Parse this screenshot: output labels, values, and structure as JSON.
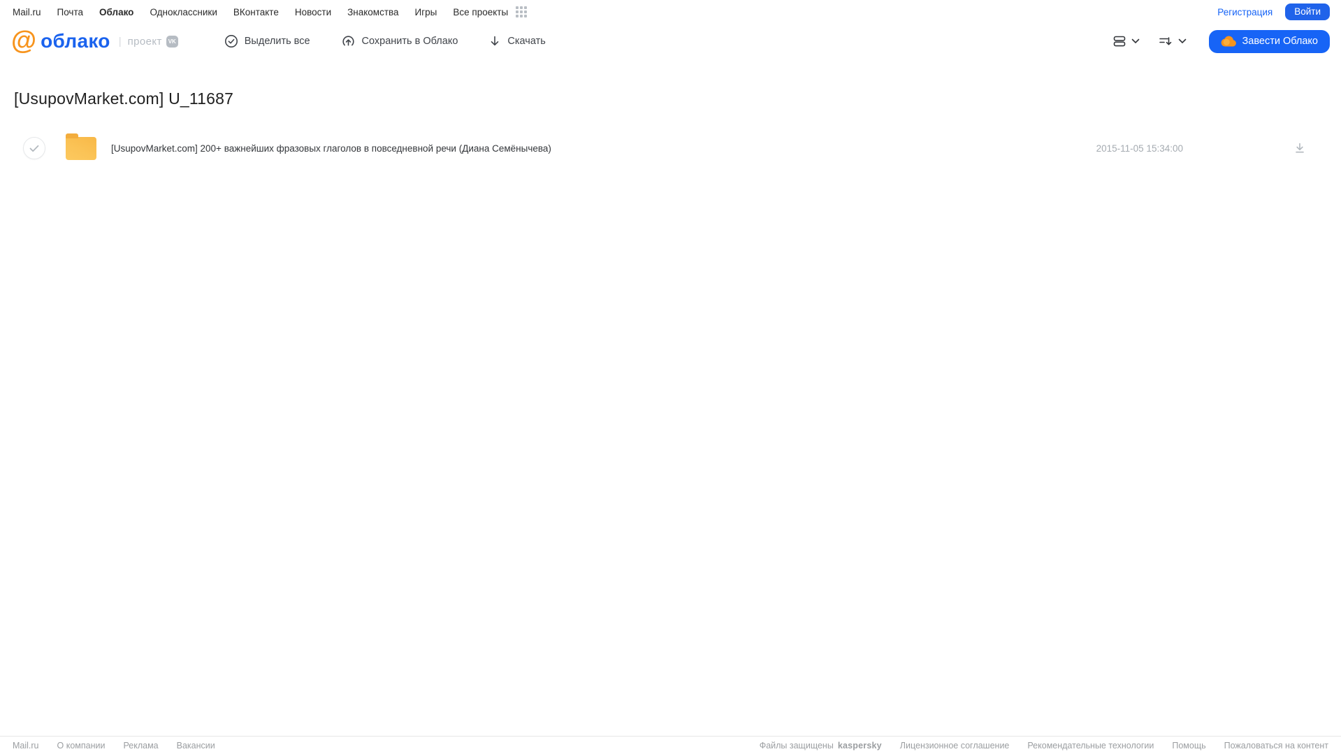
{
  "topnav": {
    "items": [
      {
        "label": "Mail.ru",
        "active": false
      },
      {
        "label": "Почта",
        "active": false
      },
      {
        "label": "Облако",
        "active": true
      },
      {
        "label": "Одноклассники",
        "active": false
      },
      {
        "label": "ВКонтакте",
        "active": false
      },
      {
        "label": "Новости",
        "active": false
      },
      {
        "label": "Знакомства",
        "active": false
      },
      {
        "label": "Игры",
        "active": false
      },
      {
        "label": "Все проекты",
        "active": false
      }
    ],
    "registration_label": "Регистрация",
    "login_label": "Войти"
  },
  "header": {
    "logo_at": "@",
    "logo_word": "облако",
    "logo_divider": "|",
    "logo_project": "проект",
    "vk_badge": "VK",
    "toolbar": {
      "select_all": "Выделить все",
      "save_to_cloud": "Сохранить в Облако",
      "download": "Скачать"
    },
    "get_cloud_label": "Завести Облако"
  },
  "page": {
    "title": "[UsupovMarket.com] U_11687"
  },
  "files": [
    {
      "type": "folder",
      "name": "[UsupovMarket.com] 200+ важнейших фразовых глаголов в повседневной речи (Диана Семёнычева)",
      "date": "2015-11-05 15:34:00"
    }
  ],
  "footer": {
    "left_items": [
      "Mail.ru",
      "О компании",
      "Реклама",
      "Вакансии"
    ],
    "protected_by": "Файлы защищены",
    "kaspersky": "kaspersky",
    "right_items": [
      "Лицензионное соглашение",
      "Рекомендательные технологии",
      "Помощь",
      "Пожаловаться на контент"
    ]
  },
  "colors": {
    "accent_blue": "#1764f6",
    "logo_orange": "#f7941d",
    "logo_blue": "#1b63ee",
    "folder_yellow": "#fbc356",
    "kaspersky_green": "#00806c"
  }
}
